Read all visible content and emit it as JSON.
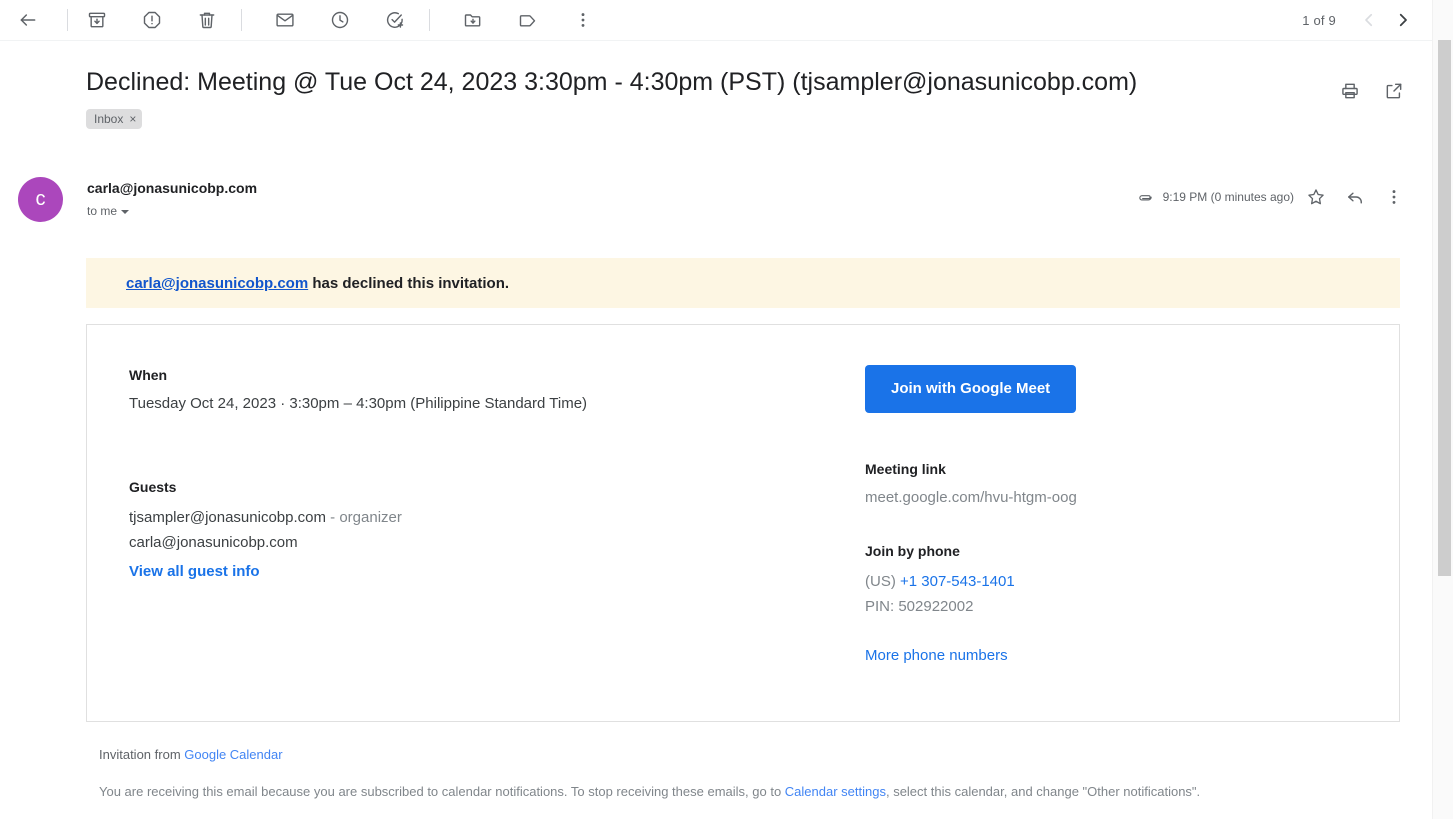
{
  "toolbar": {
    "back_label": "Back",
    "icons": [
      {
        "name": "back-icon",
        "title": "Back"
      },
      {
        "name": "archive-icon",
        "title": "Archive"
      },
      {
        "name": "report-spam-icon",
        "title": "Report spam"
      },
      {
        "name": "delete-icon",
        "title": "Delete"
      },
      {
        "name": "mark-unread-icon",
        "title": "Mark as unread"
      },
      {
        "name": "snooze-icon",
        "title": "Snooze"
      },
      {
        "name": "add-to-tasks-icon",
        "title": "Add to tasks"
      },
      {
        "name": "move-to-icon",
        "title": "Move to"
      },
      {
        "name": "labels-icon",
        "title": "Labels"
      },
      {
        "name": "more-options-icon",
        "title": "More"
      }
    ],
    "pager_count": "1 of 9",
    "prev_label": "Newer",
    "next_label": "Older"
  },
  "email": {
    "subject": "Declined: Meeting @ Tue Oct 24, 2023 3:30pm - 4:30pm (PST) (tjsampler@jonasunicobp.com)",
    "label_chip": "Inbox",
    "label_chip_remove": "×",
    "print_label": "Print all",
    "popout_label": "Open in new window",
    "sender": "carla@jonasunicobp.com",
    "avatar_letter": "c",
    "recipient": "to me",
    "timestamp": "9:19 PM (0 minutes ago)",
    "star_label": "Not starred",
    "reply_label": "Reply",
    "more_label": "More"
  },
  "banner": {
    "link_text": "carla@jonasunicobp.com",
    "rest_text": " has declined this invitation.",
    "background": "#fdf6e3"
  },
  "invite": {
    "when_heading": "When",
    "when_value": "Tuesday Oct 24, 2023 · 3:30pm – 4:30pm (Philippine Standard Time)",
    "guests_heading": "Guests",
    "guests": [
      {
        "email": "tjsampler@jonasunicobp.com",
        "role": " - organizer"
      },
      {
        "email": "carla@jonasunicobp.com",
        "role": ""
      }
    ],
    "view_all_guest_info": "View all guest info",
    "join_button": "Join with Google Meet",
    "meeting_link_heading": "Meeting link",
    "meeting_link_value": "meet.google.com/hvu-htgm-oog",
    "join_by_phone_heading": "Join by phone",
    "phone_country": "(US) ",
    "phone_number": "+1 307-543-1401",
    "pin": "PIN: 502922002",
    "more_phone_numbers": "More phone numbers",
    "accent_color": "#1a73e8"
  },
  "footer": {
    "invitation_prefix": "Invitation from ",
    "invitation_link": "Google Calendar",
    "notice_part1": "You are receiving this email because you are subscribed to calendar notifications. To stop receiving these emails, go to ",
    "notice_link": "Calendar settings",
    "notice_part2": ", select this calendar, and change \"Other notifications\"."
  }
}
